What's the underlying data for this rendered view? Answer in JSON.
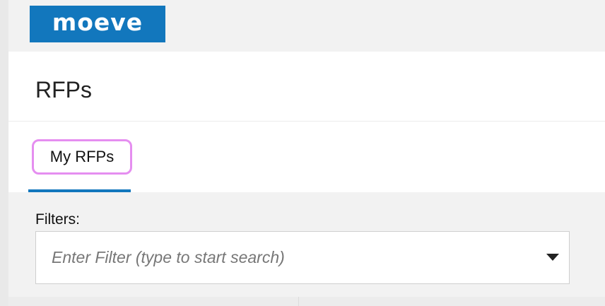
{
  "brand": {
    "logo_text": "moeve",
    "logo_color": "#1277bd"
  },
  "header": {
    "page_title": "RFPs"
  },
  "tabs": [
    {
      "label": "My RFPs",
      "active": true
    }
  ],
  "filters": {
    "label": "Filters:",
    "value": "",
    "placeholder": "Enter Filter (type to start search)",
    "dropdown_icon": "caret-down-icon"
  },
  "colors": {
    "accent": "#1277bd",
    "tab_highlight_border": "#e58ef0"
  }
}
